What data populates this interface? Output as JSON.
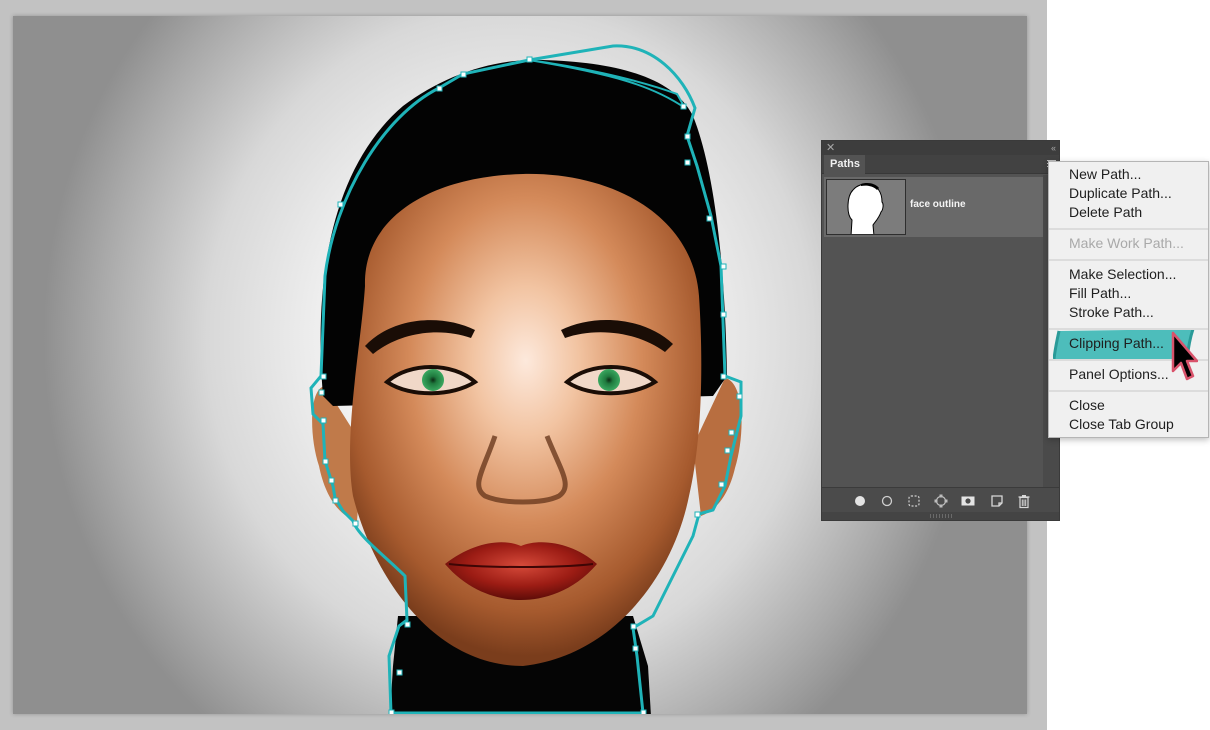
{
  "document": {
    "image_subject": "portrait of a woman with dark hair, red lips and green eyes",
    "path_outline_color": "#1fb3b8",
    "path_anchor_color": "#ffffff"
  },
  "paths_panel": {
    "close_glyph": "✕",
    "collapse_glyph": "‹‹",
    "tab_label": "Paths",
    "paths": [
      {
        "name": "face outline",
        "thumbnail": "face-outline-thumbnail"
      }
    ],
    "footer_icons": [
      {
        "name": "fill-path-icon",
        "tooltip": "Fill path with foreground color"
      },
      {
        "name": "stroke-path-icon",
        "tooltip": "Stroke path with brush"
      },
      {
        "name": "load-path-as-selection-icon",
        "tooltip": "Load path as a selection"
      },
      {
        "name": "make-work-path-icon",
        "tooltip": "Make work path from selection"
      },
      {
        "name": "add-mask-icon",
        "tooltip": "Add a mask"
      },
      {
        "name": "new-path-icon",
        "tooltip": "Create new path"
      },
      {
        "name": "delete-path-icon",
        "tooltip": "Delete current path"
      }
    ]
  },
  "context_menu": {
    "items": [
      {
        "label": "New Path...",
        "enabled": true
      },
      {
        "label": "Duplicate Path...",
        "enabled": true
      },
      {
        "label": "Delete Path",
        "enabled": true
      },
      {
        "label": "Make Work Path...",
        "enabled": false
      },
      {
        "label": "Make Selection...",
        "enabled": true
      },
      {
        "label": "Fill Path...",
        "enabled": true
      },
      {
        "label": "Stroke Path...",
        "enabled": true
      },
      {
        "label": "Clipping Path...",
        "enabled": true,
        "highlighted": true
      },
      {
        "label": "Panel Options...",
        "enabled": true
      },
      {
        "label": "Close",
        "enabled": true
      },
      {
        "label": "Close Tab Group",
        "enabled": true
      }
    ],
    "highlight_color": "#4dbdbb",
    "cursor_outline_color": "#d9536b"
  }
}
